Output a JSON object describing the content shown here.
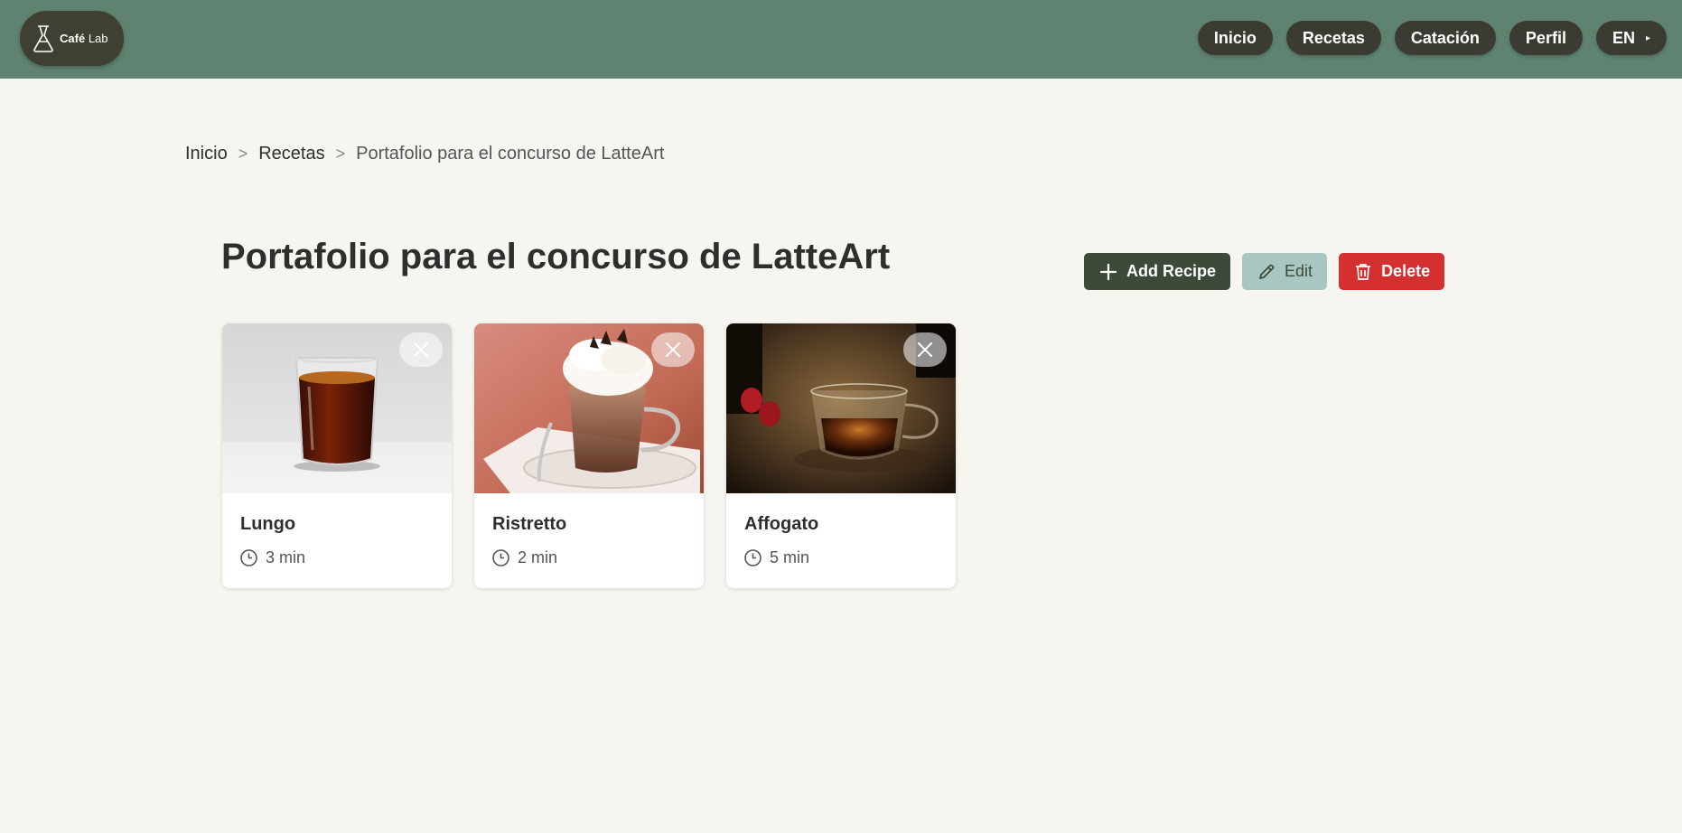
{
  "brand": {
    "bold": "Café",
    "rest": "Lab"
  },
  "nav": {
    "items": [
      "Inicio",
      "Recetas",
      "Catación",
      "Perfil"
    ],
    "language": "EN",
    "language_caret": "▸"
  },
  "breadcrumb": {
    "home": "Inicio",
    "section": "Recetas",
    "current": "Portafolio para el concurso de LatteArt",
    "separator": ">"
  },
  "page": {
    "title": "Portafolio para el concurso de LatteArt"
  },
  "actions": {
    "add": "Add Recipe",
    "edit": "Edit",
    "delete": "Delete"
  },
  "recipes": [
    {
      "name": "Lungo",
      "time": "3 min",
      "image": "lungo-glass-photo"
    },
    {
      "name": "Ristretto",
      "time": "2 min",
      "image": "ristretto-cream-photo"
    },
    {
      "name": "Affogato",
      "time": "5 min",
      "image": "affogato-glass-photo"
    }
  ],
  "colors": {
    "header": "#5f8271",
    "nav_button": "#3b3b33",
    "background": "#f7f5f0",
    "add_button": "#3d4a3a",
    "edit_button": "#a9c7c2",
    "delete_button": "#d43030"
  }
}
